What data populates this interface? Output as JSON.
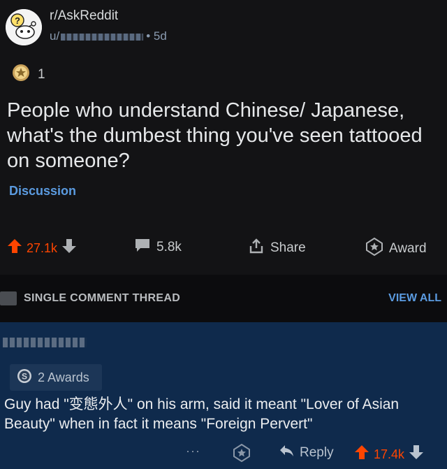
{
  "post": {
    "subreddit": "r/AskReddit",
    "user_prefix": "u/",
    "age": "• 5d",
    "award_count": "1",
    "title": "People who understand Chinese/ Japanese, what's the dumbest thing you've seen tattooed on someone?",
    "flair": "Discussion",
    "upvotes": "27.1k",
    "comments": "5.8k",
    "share_label": "Share",
    "award_label": "Award"
  },
  "thread": {
    "label": "SINGLE COMMENT THREAD",
    "view_all": "VIEW ALL"
  },
  "comment": {
    "awards": "2 Awards",
    "body": "Guy had \"变態外人\" on his arm, said it meant \"Lover of Asian Beauty\" when in fact it means \"Foreign Pervert\"",
    "more": "···",
    "reply_label": "Reply",
    "upvotes": "17.4k"
  },
  "colors": {
    "background": "#131315",
    "comment_background": "#0f2a4c",
    "upvote": "#ff4500",
    "link": "#5b9be0"
  },
  "icons": [
    "subreddit-avatar-icon",
    "award-icon",
    "upvote-icon",
    "downvote-icon",
    "comment-icon",
    "share-icon",
    "award-star-icon",
    "thread-icon",
    "reply-icon",
    "more-icon"
  ]
}
